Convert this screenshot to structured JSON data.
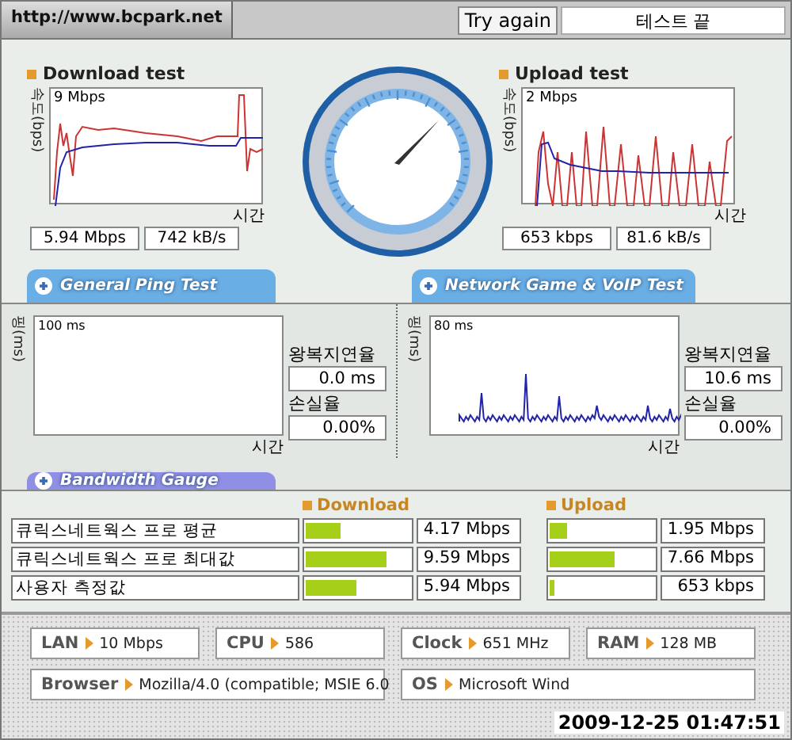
{
  "header": {
    "site": "http://www.bcpark.net",
    "button": "Try again",
    "status": "테스트 끝"
  },
  "speed_tests": [
    {
      "title": "Download test",
      "axis": "속도(bps)",
      "top_label": "9 Mbps",
      "x_label": "시간",
      "readings": [
        "5.94 Mbps",
        "742 kB/s"
      ]
    },
    {
      "title": "Upload test",
      "axis": "속도(bps)",
      "top_label": "2 Mbps",
      "x_label": "시간",
      "readings": [
        "653 kbps",
        "81.6 kB/s"
      ]
    }
  ],
  "section_tabs": [
    {
      "label": "General Ping Test"
    },
    {
      "label": "Network Game & VoIP Test"
    }
  ],
  "ping_tests": [
    {
      "axis": "핑(ms)",
      "top_label": "100 ms",
      "x_label": "시간",
      "rtt_label": "왕복지연율",
      "rtt": "0.0 ms",
      "loss_label": "손실율",
      "loss": "0.00%"
    },
    {
      "axis": "핑(ms)",
      "top_label": "80 ms",
      "x_label": "시간",
      "rtt_label": "왕복지연율",
      "rtt": "10.6 ms",
      "loss_label": "손실율",
      "loss": "0.00%"
    }
  ],
  "bandwidth": {
    "tab": "Bandwidth Gauge",
    "columns": [
      "Download",
      "Upload"
    ],
    "rows": [
      {
        "label": "큐릭스네트웍스 프로 평균",
        "download": {
          "level": 0.34,
          "value": "4.17 Mbps"
        },
        "upload": {
          "level": 0.16,
          "value": "1.95 Mbps"
        }
      },
      {
        "label": "큐릭스네트웍스 프로 최대값",
        "download": {
          "level": 0.78,
          "value": "9.59 Mbps"
        },
        "upload": {
          "level": 0.62,
          "value": "7.66 Mbps"
        }
      },
      {
        "label": "사용자 측정값",
        "download": {
          "level": 0.49,
          "value": "5.94 Mbps"
        },
        "upload": {
          "level": 0.05,
          "value": "653 kbps"
        }
      }
    ]
  },
  "system_info": [
    {
      "label": "LAN",
      "value": "10 Mbps"
    },
    {
      "label": "CPU",
      "value": "586"
    },
    {
      "label": "Clock",
      "value": "651 MHz"
    },
    {
      "label": "RAM",
      "value": "128 MB"
    },
    {
      "label": "Browser",
      "value": "Mozilla/4.0 (compatible; MSIE 6.0"
    },
    {
      "label": "OS",
      "value": "Microsoft Wind"
    }
  ],
  "timestamp": "2009-12-25 01:47:51"
}
